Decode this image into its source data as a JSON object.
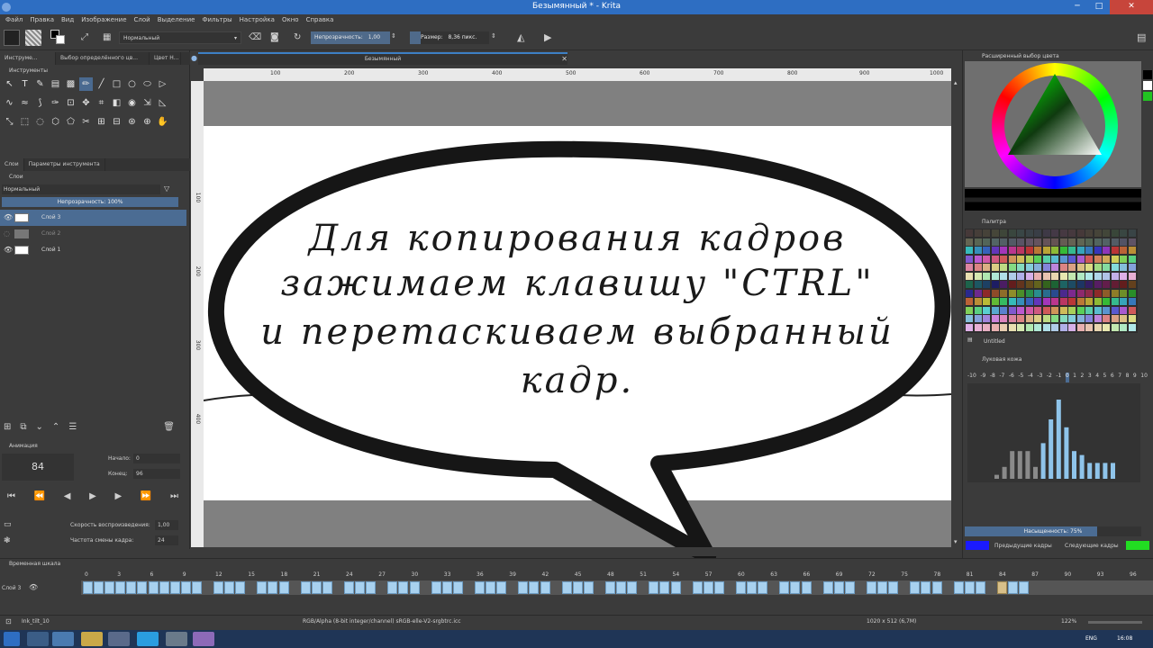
{
  "window": {
    "title": "Безымянный * - Krita",
    "minimize": "─",
    "maximize": "□",
    "close": "✕"
  },
  "menu": [
    "Файл",
    "Правка",
    "Вид",
    "Изображение",
    "Слой",
    "Выделение",
    "Фильтры",
    "Настройка",
    "Окно",
    "Справка"
  ],
  "toolbar": {
    "blend_mode": "Нормальный",
    "opacity_label": "Непрозрачность:",
    "opacity_value": "1,00",
    "size_label": "Размер:",
    "size_value": "8,36 пикс."
  },
  "left_dock": {
    "tabs": [
      "Инструме...",
      "Выбор определённого цв...",
      "Цвет Н..."
    ],
    "tools_header": "Инструменты",
    "tools": [
      "↖",
      "T",
      "✎",
      "▤",
      "▩",
      "✏",
      "╱",
      "□",
      "○",
      "⬭",
      "▷",
      "∿",
      "≈",
      "⟆",
      "✑",
      "⊡",
      "✥",
      "⌗",
      "◧",
      "◉",
      "⇲",
      "◺",
      "⤡",
      "⬚",
      "◌",
      "⬡",
      "⬠",
      "✂",
      "⊞",
      "⊟",
      "⊛",
      "⊕",
      "✋"
    ],
    "layer_tabs": [
      "Слои",
      "Параметры инструмента"
    ],
    "layers_header": "Слои",
    "layer_blend": "Нормальный",
    "layer_opacity": "Непрозрачность: 100%",
    "layers": [
      {
        "name": "Слой 3",
        "selected": true
      },
      {
        "name": "Слой 2",
        "selected": false
      },
      {
        "name": "Слой 1",
        "selected": false
      }
    ],
    "animation_header": "Анимация",
    "current_frame": "84",
    "start_label": "Начало:",
    "start_value": "0",
    "end_label": "Конец:",
    "end_value": "96",
    "speed_label": "Скорость воспроизведения:",
    "speed_value": "1,00",
    "fps_label": "Частота смены кадра:",
    "fps_value": "24"
  },
  "document": {
    "tab_title": "Безымянный",
    "ruler_top": [
      "100",
      "200",
      "300",
      "400",
      "500",
      "600",
      "700",
      "800",
      "900",
      "1000"
    ],
    "ruler_left": [
      "100",
      "200",
      "300",
      "400"
    ],
    "caption_lines": [
      "Для копирования кадров",
      "зажимаем клавишу \"CTRL\"",
      "и перетаскиваем  выбранный",
      "кадр."
    ]
  },
  "right_dock": {
    "color_header": "Расширенный выбор цвета",
    "palette_header": "Палитра",
    "palette_name": "Untitled",
    "onion_header": "Луковая кожа",
    "onion_offsets": [
      "-10",
      "-9",
      "-8",
      "-7",
      "-6",
      "-5",
      "-4",
      "-3",
      "-2",
      "-1",
      "0",
      "1",
      "2",
      "3",
      "4",
      "5",
      "6",
      "7",
      "8",
      "9",
      "10"
    ],
    "onion_bars": [
      0.05,
      0.15,
      0.35,
      0.35,
      0.35,
      0.15,
      0.45,
      0.75,
      1.0,
      0.65,
      0.35,
      0.3,
      0.2,
      0.2,
      0.2,
      0.2
    ],
    "saturation": "Насыщенность: 75%",
    "prev_frames": "Предыдущие кадры",
    "next_frames": "Следующие кадры",
    "prev_color": "#1a1aff",
    "next_color": "#22dd22"
  },
  "timeline": {
    "header": "Временная шкала",
    "layer": "Слой 3",
    "ticks": [
      "0",
      "3",
      "6",
      "9",
      "12",
      "15",
      "18",
      "21",
      "24",
      "27",
      "30",
      "33",
      "36",
      "39",
      "42",
      "45",
      "48",
      "51",
      "54",
      "57",
      "60",
      "63",
      "66",
      "69",
      "72",
      "75",
      "78",
      "81",
      "84",
      "87",
      "90",
      "93",
      "96"
    ]
  },
  "status": {
    "brush": "Ink_tilt_10",
    "color_space": "RGB/Alpha (8-bit integer/channel)  sRGB-elle-V2-srgbtrc.icc",
    "dimensions": "1020 x 512 (6,7M)",
    "zoom": "122%"
  },
  "taskbar": {
    "lang": "ENG",
    "time": "16:08"
  }
}
